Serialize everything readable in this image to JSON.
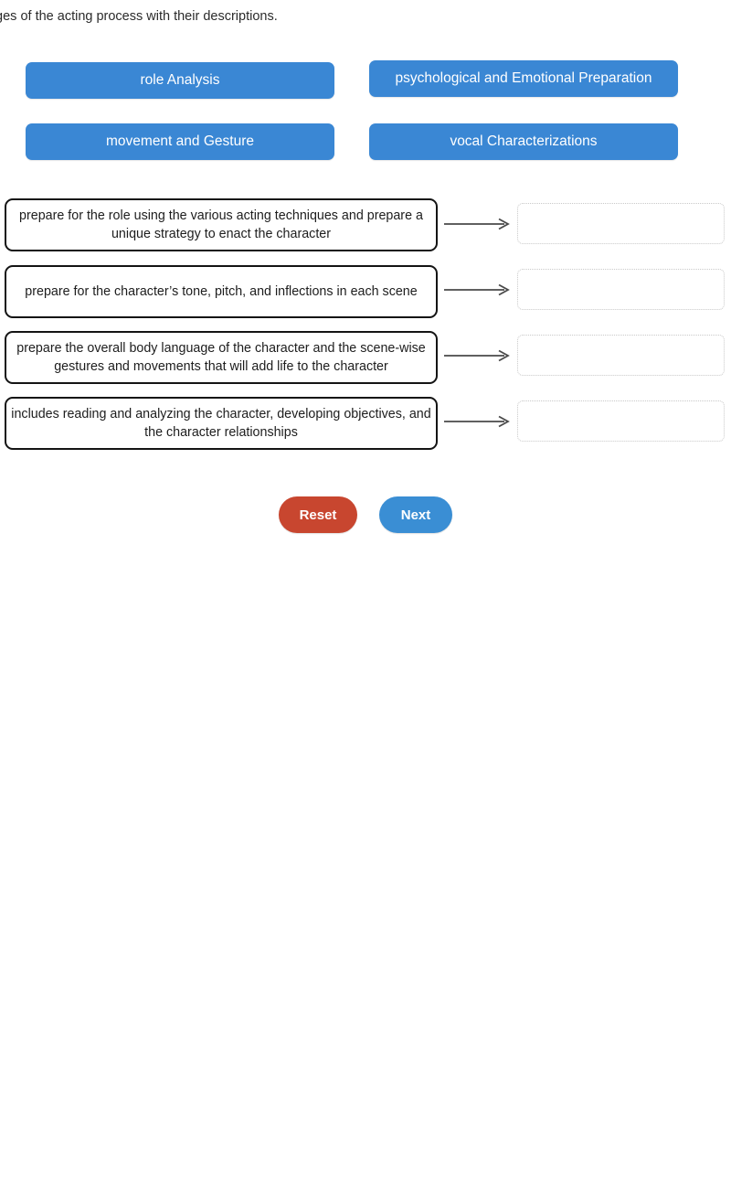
{
  "question": {
    "prompt_text": "Match the stages of the acting process with their descriptions."
  },
  "colors": {
    "chip_blue": "#3a87d4",
    "reset_red": "#c8462f",
    "next_blue": "#3a8ed4",
    "desc_border": "#141414",
    "dropzone_border": "#c9c9c9"
  },
  "terms": [
    {
      "label": "role Analysis"
    },
    {
      "label": "psychological and Emotional Preparation"
    },
    {
      "label": "movement and Gesture"
    },
    {
      "label": "vocal Characterizations"
    }
  ],
  "matches": [
    {
      "description": "prepare for the role using the various acting techniques and prepare a unique strategy to enact the character",
      "answer": ""
    },
    {
      "description": "prepare for the character’s tone, pitch, and inflections in each scene",
      "answer": ""
    },
    {
      "description": "prepare the overall body language of the character and the scene-wise gestures and movements that will add life to the character",
      "answer": ""
    },
    {
      "description": "includes reading and analyzing the character, developing objectives, and the character relationships",
      "answer": ""
    }
  ],
  "actions": {
    "reset_label": "Reset",
    "next_label": "Next"
  }
}
